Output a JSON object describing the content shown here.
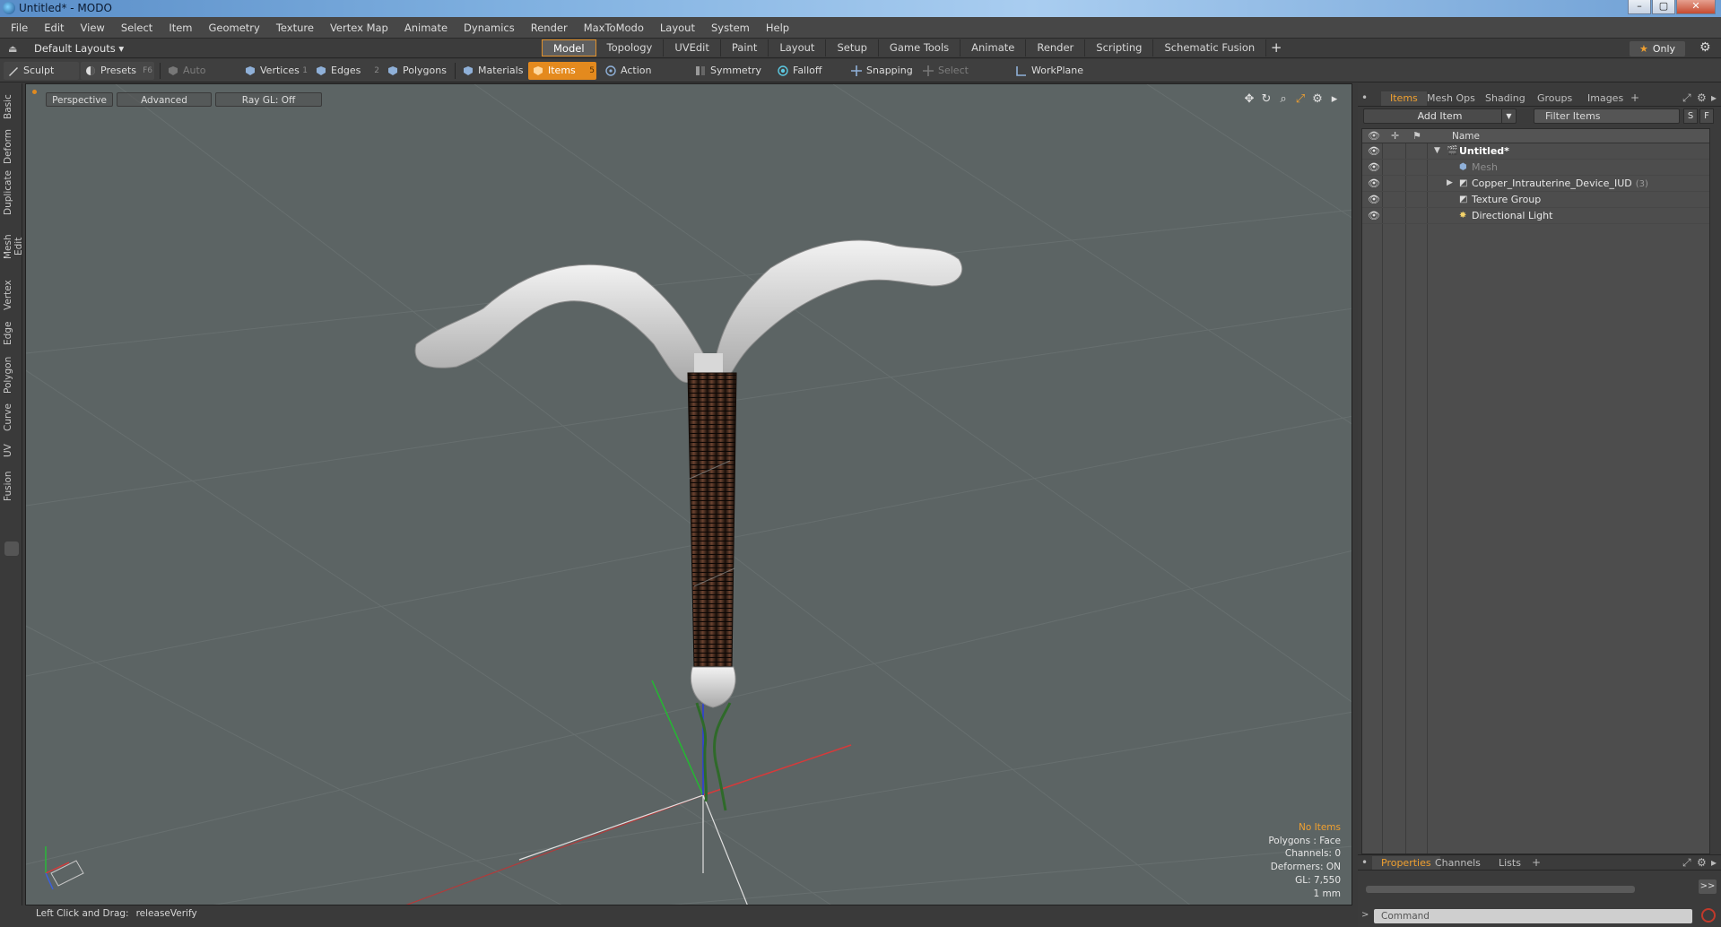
{
  "window": {
    "title": "Untitled* - MODO",
    "minimize": "–",
    "maximize": "▢",
    "close": "✕"
  },
  "menu": [
    "File",
    "Edit",
    "View",
    "Select",
    "Item",
    "Geometry",
    "Texture",
    "Vertex Map",
    "Animate",
    "Dynamics",
    "Render",
    "MaxToModo",
    "Layout",
    "System",
    "Help"
  ],
  "layout_bar": {
    "layouts_label": "Default Layouts ▾",
    "tabs": [
      "Model",
      "Topology",
      "UVEdit",
      "Paint",
      "Layout",
      "Setup",
      "Game Tools",
      "Animate",
      "Render",
      "Scripting",
      "Schematic Fusion"
    ],
    "active_tab": "Model",
    "add_tab": "+",
    "only_label": "Only"
  },
  "toolbar": {
    "sculpt": "Sculpt",
    "presets": "Presets",
    "presets_hotkey": "F6",
    "auto_select": "Auto Select",
    "vertices": "Vertices",
    "vertices_hotkey": "1",
    "edges": "Edges",
    "edges_hotkey": "2",
    "polygons": "Polygons",
    "materials": "Materials",
    "items": "Items",
    "items_hotkey": "5",
    "action_center": "Action Center",
    "symmetry": "Symmetry",
    "falloff": "Falloff",
    "snapping": "Snapping",
    "select_through": "Select Through",
    "workplane": "WorkPlane"
  },
  "left_tabs": [
    "Basic",
    "Deform",
    "Duplicate",
    "Mesh Edit",
    "Vertex",
    "Edge",
    "Polygon",
    "Curve",
    "UV",
    "Fusion"
  ],
  "viewport": {
    "view_mode": "Perspective",
    "shading": "Advanced",
    "ray_gl": "Ray GL: Off",
    "info": {
      "selection": "No Items",
      "polygons": "Polygons : Face",
      "channels": "Channels: 0",
      "deformers": "Deformers: ON",
      "gl": "GL: 7,550",
      "scale": "1 mm"
    }
  },
  "status": {
    "hint": "Left Click and Drag:",
    "action": "releaseVerify"
  },
  "right_panel": {
    "tabs": [
      "Items",
      "Mesh Ops",
      "Shading",
      "Groups",
      "Images"
    ],
    "active_tab": "Items",
    "add_item": "Add Item",
    "filter_placeholder": "Filter Items",
    "s_btn": "S",
    "f_btn": "F",
    "column_name": "Name",
    "items": [
      {
        "label": "Untitled*",
        "count": ""
      },
      {
        "label": "Mesh",
        "count": ""
      },
      {
        "label": "Copper_Intrauterine_Device_IUD",
        "count": "(3)"
      },
      {
        "label": "Texture Group",
        "count": ""
      },
      {
        "label": "Directional Light",
        "count": ""
      }
    ],
    "bottom_tabs": [
      "Properties",
      "Channels",
      "Lists"
    ],
    "bottom_active": "Properties",
    "forward_btn": ">>",
    "command_placeholder": "Command"
  },
  "colors": {
    "accent": "#e48a1e",
    "viewport_bg": "#5c6464",
    "panel_bg": "#3b3b3b",
    "coil": "#3a2418"
  }
}
